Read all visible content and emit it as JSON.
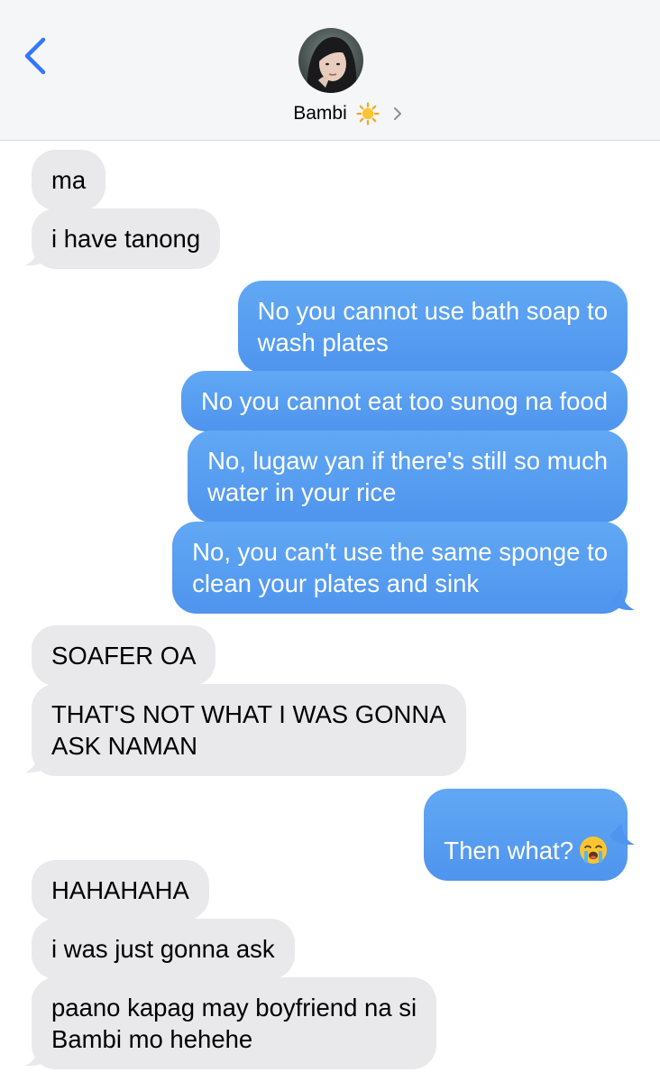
{
  "header": {
    "contact_name": "Bambi",
    "status_emoji": "sun-emoji",
    "avatar": "contact-photo"
  },
  "messages": [
    {
      "from": "contact",
      "text": "ma"
    },
    {
      "from": "contact",
      "text": "i have tanong"
    },
    {
      "from": "me",
      "text": "No you cannot use bath soap to\nwash plates"
    },
    {
      "from": "me",
      "text": "No you cannot eat too sunog na food"
    },
    {
      "from": "me",
      "text": "No, lugaw yan if there's still so much\nwater in your rice"
    },
    {
      "from": "me",
      "text": "No, you can't use the same sponge to\nclean your plates and sink"
    },
    {
      "from": "contact",
      "text": "SOAFER OA"
    },
    {
      "from": "contact",
      "text": "THAT'S NOT WHAT I WAS GONNA\nASK NAMAN"
    },
    {
      "from": "me",
      "text": "Then what?",
      "emoji": "loudly-crying-face"
    },
    {
      "from": "contact",
      "text": "HAHAHAHA"
    },
    {
      "from": "contact",
      "text": "i was just gonna ask"
    },
    {
      "from": "contact",
      "text": "paano kapag may boyfriend na si\nBambi mo hehehe"
    }
  ],
  "colors": {
    "incoming_bubble": "#e9e9eb",
    "outgoing_bubble": "#5a9ff2",
    "accent": "#3478f6"
  }
}
